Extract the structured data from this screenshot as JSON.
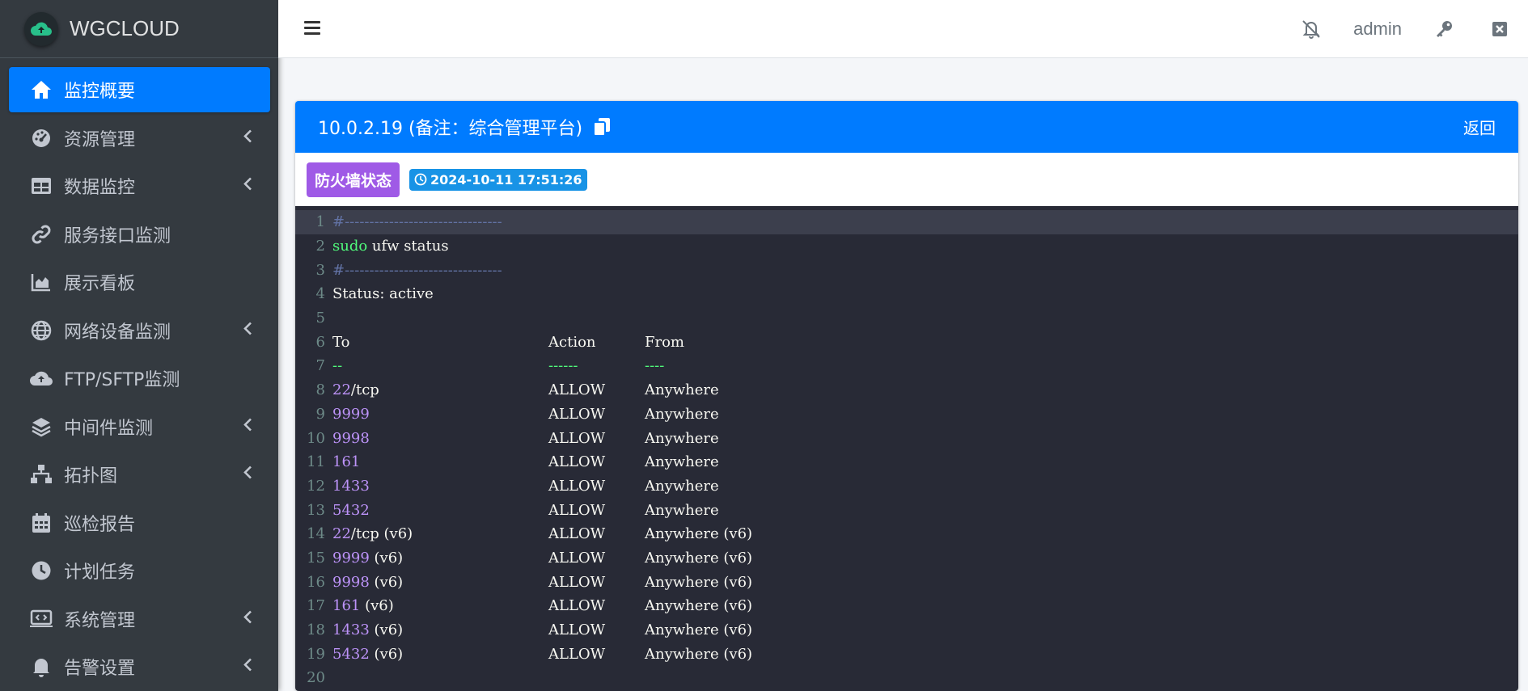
{
  "app": {
    "brand": "WGCLOUD"
  },
  "sidebar": {
    "items": [
      {
        "label": "监控概要",
        "icon": "home-icon",
        "active": true,
        "expandable": false
      },
      {
        "label": "资源管理",
        "icon": "dashboard-gauge-icon",
        "active": false,
        "expandable": true
      },
      {
        "label": "数据监控",
        "icon": "table-icon",
        "active": false,
        "expandable": true
      },
      {
        "label": "服务接口监测",
        "icon": "link-icon",
        "active": false,
        "expandable": false
      },
      {
        "label": "展示看板",
        "icon": "area-chart-icon",
        "active": false,
        "expandable": false
      },
      {
        "label": "网络设备监测",
        "icon": "globe-icon",
        "active": false,
        "expandable": true
      },
      {
        "label": "FTP/SFTP监测",
        "icon": "cloud-upload-icon",
        "active": false,
        "expandable": false
      },
      {
        "label": "中间件监测",
        "icon": "layers-icon",
        "active": false,
        "expandable": true
      },
      {
        "label": "拓扑图",
        "icon": "sitemap-icon",
        "active": false,
        "expandable": true
      },
      {
        "label": "巡检报告",
        "icon": "calendar-icon",
        "active": false,
        "expandable": false
      },
      {
        "label": "计划任务",
        "icon": "clock-icon",
        "active": false,
        "expandable": false
      },
      {
        "label": "系统管理",
        "icon": "laptop-code-icon",
        "active": false,
        "expandable": true
      },
      {
        "label": "告警设置",
        "icon": "bell-icon",
        "active": false,
        "expandable": true
      }
    ]
  },
  "header": {
    "user": "admin"
  },
  "card": {
    "title": "10.0.2.19 (备注：综合管理平台)",
    "back_label": "返回",
    "badge_label": "防火墙状态",
    "timestamp": "2024-10-11 17:51:26"
  },
  "colors": {
    "primary": "#007bff",
    "badge_purple": "#9f5ae6",
    "badge_blue": "#1893e6",
    "editor_bg": "#282a36"
  },
  "code": {
    "lines": [
      {
        "n": "1",
        "text": "#--------------------------------"
      },
      {
        "n": "2",
        "text": "sudo ufw status"
      },
      {
        "n": "3",
        "text": "#--------------------------------"
      },
      {
        "n": "4",
        "text": "Status: active"
      },
      {
        "n": "5",
        "text": ""
      },
      {
        "n": "6",
        "to": "To",
        "action": "Action",
        "from": "From"
      },
      {
        "n": "7",
        "to": "--",
        "action": "------",
        "from": "----"
      },
      {
        "n": "8",
        "port": "22",
        "proto": "/tcp",
        "action": "ALLOW",
        "from": "Anywhere"
      },
      {
        "n": "9",
        "port": "9999",
        "proto": "",
        "action": "ALLOW",
        "from": "Anywhere"
      },
      {
        "n": "10",
        "port": "9998",
        "proto": "",
        "action": "ALLOW",
        "from": "Anywhere"
      },
      {
        "n": "11",
        "port": "161",
        "proto": "",
        "action": "ALLOW",
        "from": "Anywhere"
      },
      {
        "n": "12",
        "port": "1433",
        "proto": "",
        "action": "ALLOW",
        "from": "Anywhere"
      },
      {
        "n": "13",
        "port": "5432",
        "proto": "",
        "action": "ALLOW",
        "from": "Anywhere"
      },
      {
        "n": "14",
        "port": "22",
        "proto": "/tcp (v6)",
        "action": "ALLOW",
        "from": "Anywhere (v6)"
      },
      {
        "n": "15",
        "port": "9999",
        "proto": " (v6)",
        "action": "ALLOW",
        "from": "Anywhere (v6)"
      },
      {
        "n": "16",
        "port": "9998",
        "proto": " (v6)",
        "action": "ALLOW",
        "from": "Anywhere (v6)"
      },
      {
        "n": "17",
        "port": "161",
        "proto": " (v6)",
        "action": "ALLOW",
        "from": "Anywhere (v6)"
      },
      {
        "n": "18",
        "port": "1433",
        "proto": " (v6)",
        "action": "ALLOW",
        "from": "Anywhere (v6)"
      },
      {
        "n": "19",
        "port": "5432",
        "proto": " (v6)",
        "action": "ALLOW",
        "from": "Anywhere (v6)"
      },
      {
        "n": "20",
        "text": ""
      }
    ]
  }
}
